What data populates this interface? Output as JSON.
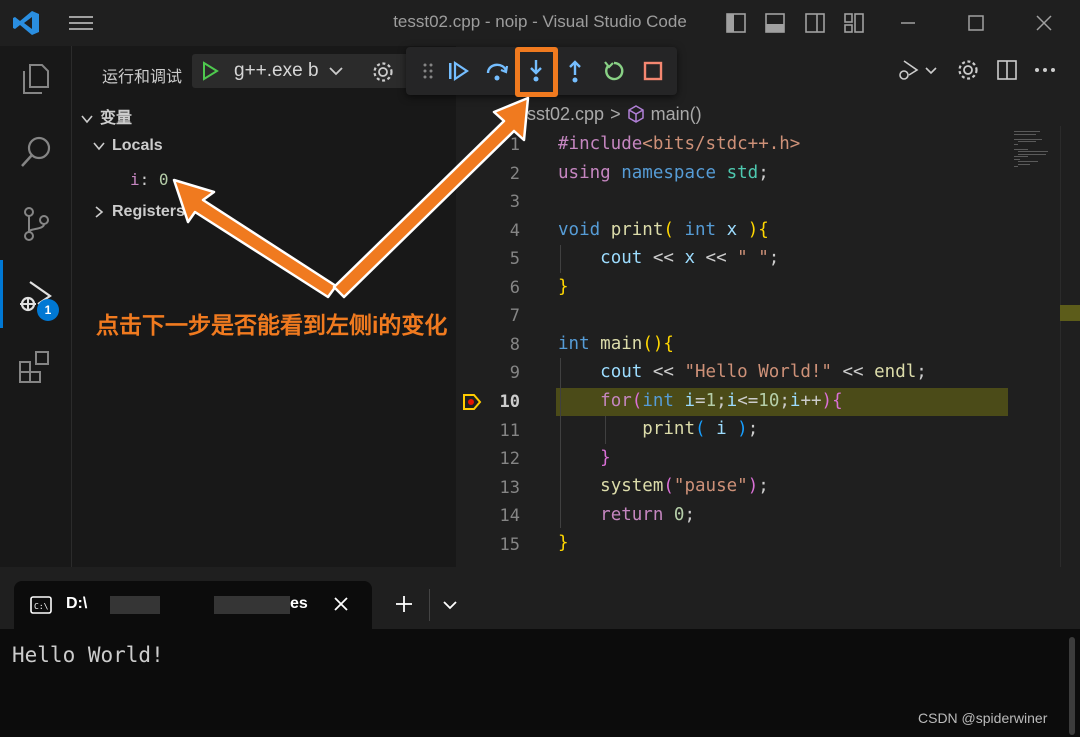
{
  "window": {
    "title": "tesst02.cpp - noip - Visual Studio Code"
  },
  "activity_bar": {
    "debug_badge": "1"
  },
  "sidebar": {
    "run_label": "运行和调试",
    "config_name": "g++.exe b",
    "section_title": "变量",
    "locals_label": "Locals",
    "variable": {
      "name": "i",
      "colon": ":",
      "value": "0"
    },
    "registers_label": "Registers"
  },
  "breadcrumb": {
    "file": "tesst02.cpp",
    "symbol": "main()"
  },
  "editor": {
    "current_line": 10,
    "line_numbers": [
      "1",
      "2",
      "3",
      "4",
      "5",
      "6",
      "7",
      "8",
      "9",
      "10",
      "11",
      "12",
      "13",
      "14",
      "15"
    ]
  },
  "annotation": {
    "text": "点击下一步是否能看到左侧i的变化"
  },
  "terminal": {
    "tab_title_start": "D:\\",
    "tab_title_end": "es",
    "output": "Hello World!"
  },
  "watermark": "CSDN @spiderwiner",
  "colors": {
    "accent": "#0078d4",
    "annotation": "#f07a1f",
    "current_line": "#4b4b18"
  }
}
